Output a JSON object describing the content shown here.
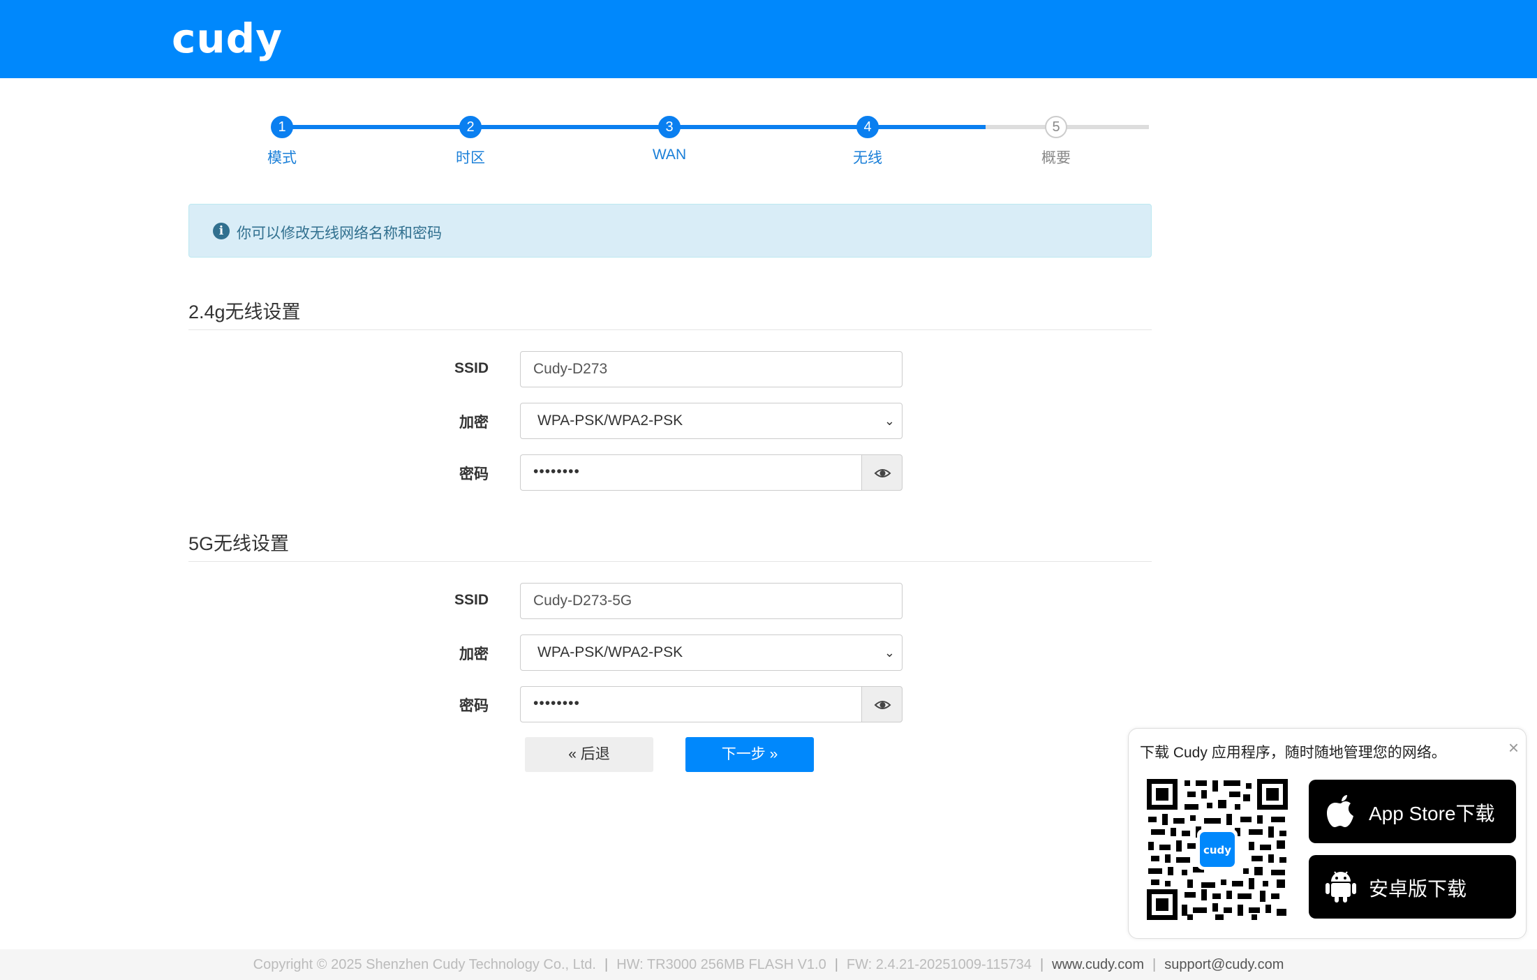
{
  "header": {
    "logo_text": "cudy",
    "bg_color": "#0088fc"
  },
  "stepper": {
    "steps": [
      {
        "number": "1",
        "label": "模式",
        "state": "done"
      },
      {
        "number": "2",
        "label": "时区",
        "state": "done"
      },
      {
        "number": "3",
        "label": "WAN",
        "state": "done"
      },
      {
        "number": "4",
        "label": "无线",
        "state": "current"
      },
      {
        "number": "5",
        "label": "概要",
        "state": "pending"
      }
    ]
  },
  "alert": {
    "icon": "info-icon",
    "text": "你可以修改无线网络名称和密码"
  },
  "wifi24": {
    "title": "2.4g无线设置",
    "ssid_label": "SSID",
    "ssid_value": "Cudy-D273",
    "encryption_label": "加密",
    "encryption_value": "WPA-PSK/WPA2-PSK",
    "password_label": "密码",
    "password_value": "••••••••"
  },
  "wifi5": {
    "title": "5G无线设置",
    "ssid_label": "SSID",
    "ssid_value": "Cudy-D273-5G",
    "encryption_label": "加密",
    "encryption_value": "WPA-PSK/WPA2-PSK",
    "password_label": "密码",
    "password_value": "••••••••"
  },
  "actions": {
    "back_label": "« 后退",
    "next_label": "下一步 »"
  },
  "popup": {
    "title": "下载 Cudy 应用程序，随时随地管理您的网络。",
    "close_label": "×",
    "qr_logo_text": "cudy",
    "appstore_label": "App Store下载",
    "android_label": "安卓版下载"
  },
  "footer": {
    "copyright": "Copyright © 2025 Shenzhen Cudy Technology Co., Ltd.",
    "hw": "HW: TR3000 256MB FLASH V1.0",
    "fw": "FW: 2.4.21-20251009-115734",
    "website": "www.cudy.com",
    "email": "support@cudy.com"
  }
}
